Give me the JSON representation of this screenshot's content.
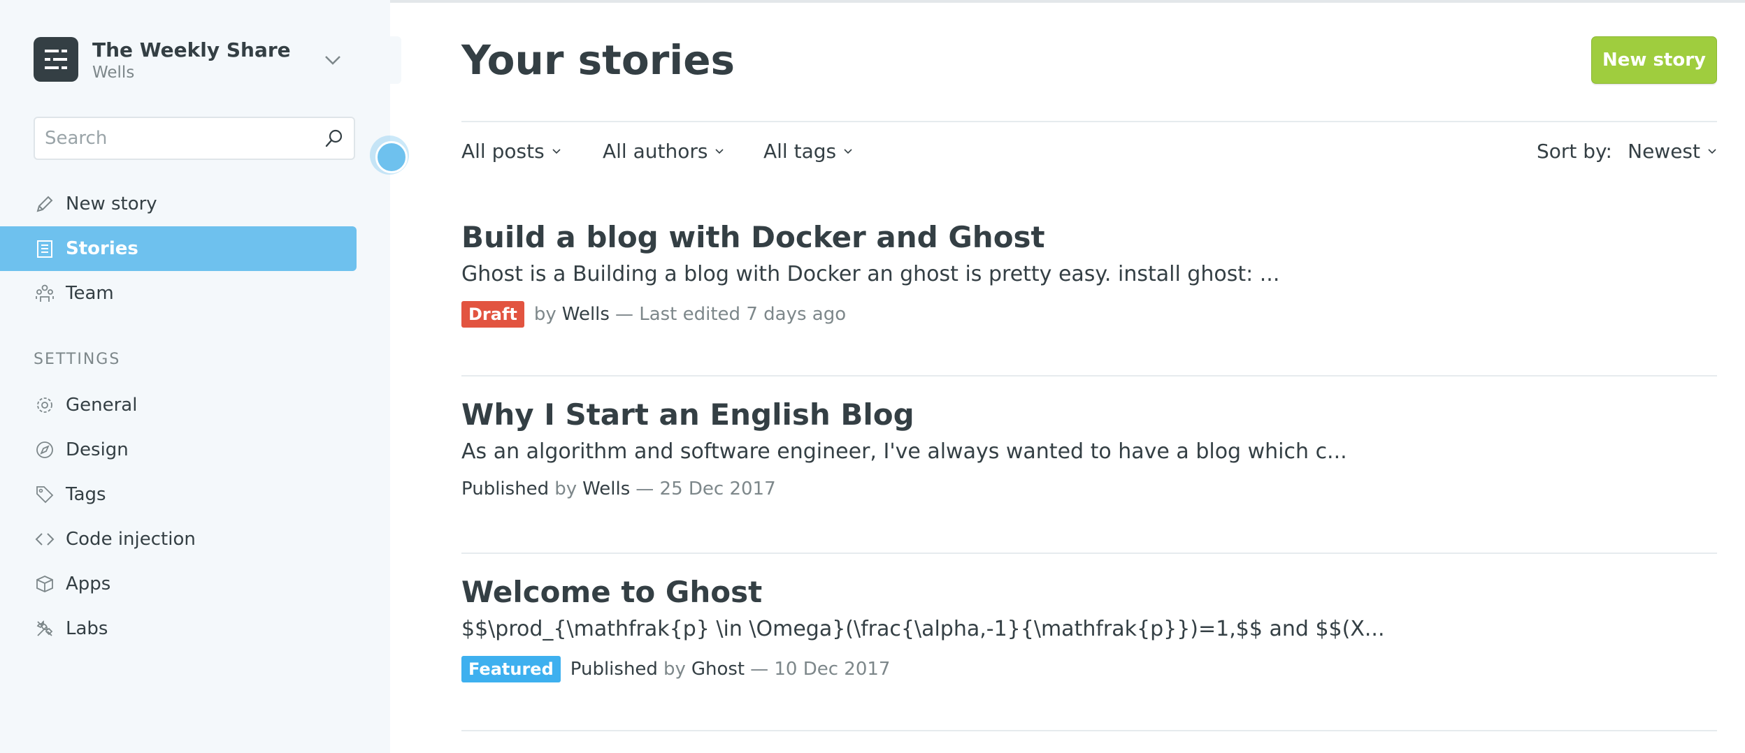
{
  "blog": {
    "title": "The Weekly Share",
    "user": "Wells"
  },
  "search": {
    "placeholder": "Search"
  },
  "nav": {
    "main": [
      {
        "label": "New story",
        "icon": "pencil-icon"
      },
      {
        "label": "Stories",
        "icon": "stories-icon",
        "active": true
      },
      {
        "label": "Team",
        "icon": "team-icon"
      }
    ],
    "settings_label": "SETTINGS",
    "settings": [
      {
        "label": "General",
        "icon": "gear-icon"
      },
      {
        "label": "Design",
        "icon": "compass-icon"
      },
      {
        "label": "Tags",
        "icon": "tag-icon"
      },
      {
        "label": "Code injection",
        "icon": "code-icon"
      },
      {
        "label": "Apps",
        "icon": "box-icon"
      },
      {
        "label": "Labs",
        "icon": "tools-icon"
      }
    ]
  },
  "main": {
    "title": "Your stories",
    "new_story_button": "New story",
    "filters": {
      "posts": "All posts",
      "authors": "All authors",
      "tags": "All tags",
      "sort_label": "Sort by:",
      "sort_value": "Newest"
    },
    "posts": [
      {
        "title": "Build a blog with Docker and Ghost",
        "excerpt": "Ghost is a Building a blog with Docker an ghost is pretty easy. install ghost: ...",
        "badge": "Draft",
        "status": "",
        "by": "by",
        "author": "Wells",
        "date": "— Last edited 7 days ago"
      },
      {
        "title": "Why I Start an English Blog",
        "excerpt": "As an algorithm and software engineer, I've always wanted to have a blog which c...",
        "badge": "",
        "status": "Published",
        "by": "by",
        "author": "Wells",
        "date": "— 25 Dec 2017"
      },
      {
        "title": "Welcome to Ghost",
        "excerpt": "$$\\prod_{\\mathfrak{p} \\in \\Omega}(\\frac{\\alpha,-1}{\\mathfrak{p}})=1,$$ and $$(X...",
        "badge": "Featured",
        "status": "Published",
        "by": "by",
        "author": "Ghost",
        "date": "— 10 Dec 2017"
      }
    ]
  },
  "colors": {
    "sidebar_bg": "#f4f8fb",
    "active_nav": "#6ec1ee",
    "primary_button": "#9fcd3e",
    "draft_badge": "#e25440",
    "featured_badge": "#3eb0ef",
    "text": "#343f44",
    "muted_text": "#7d878a"
  }
}
